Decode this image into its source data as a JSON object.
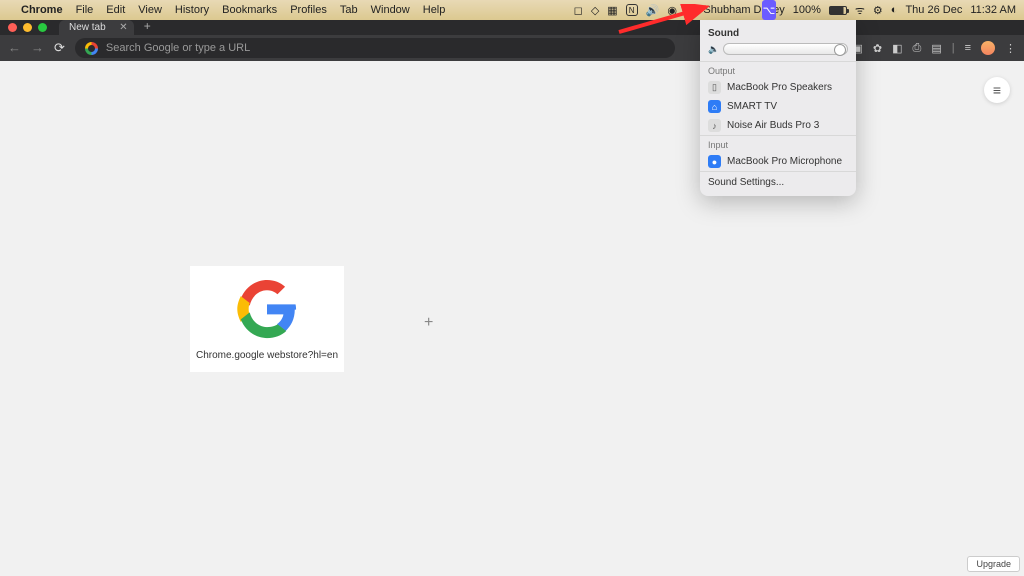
{
  "menubar": {
    "app": "Chrome",
    "items": [
      "File",
      "Edit",
      "View",
      "History",
      "Bookmarks",
      "Profiles",
      "Tab",
      "Window",
      "Help"
    ],
    "user": "Shubham Davey",
    "battery": "100%",
    "date": "Thu 26 Dec",
    "time": "11:32 AM"
  },
  "chrome": {
    "tab_title": "New tab",
    "omnibox_placeholder": "Search Google or type a URL"
  },
  "page": {
    "shortcut_label": "Chrome.google webstore?hl=en",
    "upgrade": "Upgrade"
  },
  "sound": {
    "title": "Sound",
    "output_label": "Output",
    "input_label": "Input",
    "outputs": [
      "MacBook Pro Speakers",
      "SMART TV",
      "Noise Air Buds Pro 3"
    ],
    "inputs": [
      "MacBook Pro Microphone"
    ],
    "settings": "Sound Settings..."
  }
}
